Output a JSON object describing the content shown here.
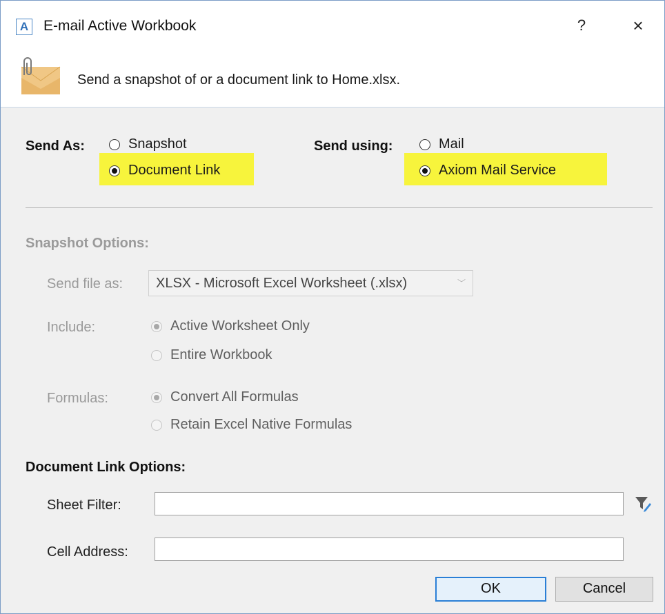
{
  "window": {
    "app_icon_letter": "A",
    "title": "E-mail Active Workbook",
    "help_label": "?",
    "close_label": "×"
  },
  "header": {
    "description": "Send a snapshot of or a document link to Home.xlsx.",
    "icon": "mail-attachment-icon"
  },
  "send_as": {
    "label": "Send As:",
    "options": [
      {
        "label": "Snapshot",
        "selected": false
      },
      {
        "label": "Document Link",
        "selected": true
      }
    ]
  },
  "send_using": {
    "label": "Send using:",
    "options": [
      {
        "label": "Mail",
        "selected": false
      },
      {
        "label": "Axiom Mail Service",
        "selected": true
      }
    ]
  },
  "snapshot_options": {
    "heading": "Snapshot Options:",
    "send_file_as": {
      "label": "Send file as:",
      "value": "XLSX - Microsoft Excel Worksheet (.xlsx)"
    },
    "include": {
      "label": "Include:",
      "options": [
        {
          "label": "Active Worksheet Only",
          "selected": true
        },
        {
          "label": "Entire Workbook",
          "selected": false
        }
      ]
    },
    "formulas": {
      "label": "Formulas:",
      "options": [
        {
          "label": "Convert All Formulas",
          "selected": true
        },
        {
          "label": "Retain Excel Native Formulas",
          "selected": false
        }
      ]
    }
  },
  "document_link_options": {
    "heading": "Document Link Options:",
    "sheet_filter": {
      "label": "Sheet Filter:",
      "value": ""
    },
    "cell_address": {
      "label": "Cell Address:",
      "value": ""
    },
    "filter_button_icon": "filter-edit-icon"
  },
  "buttons": {
    "ok": "OK",
    "cancel": "Cancel"
  },
  "colors": {
    "highlight": "#f7f43c",
    "accent": "#2a7fd6",
    "icon_blue": "#2f6fb7"
  }
}
